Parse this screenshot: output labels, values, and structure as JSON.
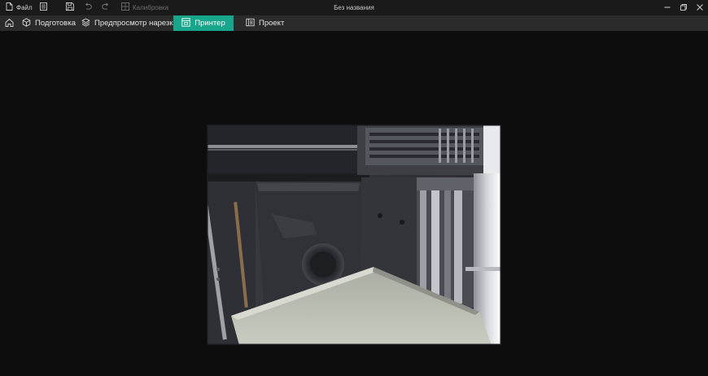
{
  "titlebar": {
    "file_label": "Файл",
    "calibration_label": "Калибровка",
    "window_title": "Без названия",
    "icons": [
      "file-icon",
      "menu-icon",
      "save-icon",
      "undo-icon",
      "redo-icon",
      "calibration-icon",
      "minimize-icon",
      "restore-icon",
      "close-icon"
    ]
  },
  "tabs": [
    {
      "id": "home",
      "icon": "home-icon"
    },
    {
      "id": "prepare",
      "label": "Подготовка",
      "icon": "cube-icon"
    },
    {
      "id": "preview",
      "label": "Предпросмотр нарезки",
      "icon": "layers-icon"
    },
    {
      "id": "printer",
      "label": "Принтер",
      "icon": "printer-icon",
      "active": true
    },
    {
      "id": "project",
      "label": "Проект",
      "icon": "project-icon"
    }
  ],
  "colors": {
    "accent": "#17a58c",
    "titlebar_bg": "#1a1a1a",
    "tabbar_bg": "#2b2b2b",
    "content_bg": "#0d0d0d"
  },
  "main": {
    "camera_feed": "printer-camera-view"
  }
}
